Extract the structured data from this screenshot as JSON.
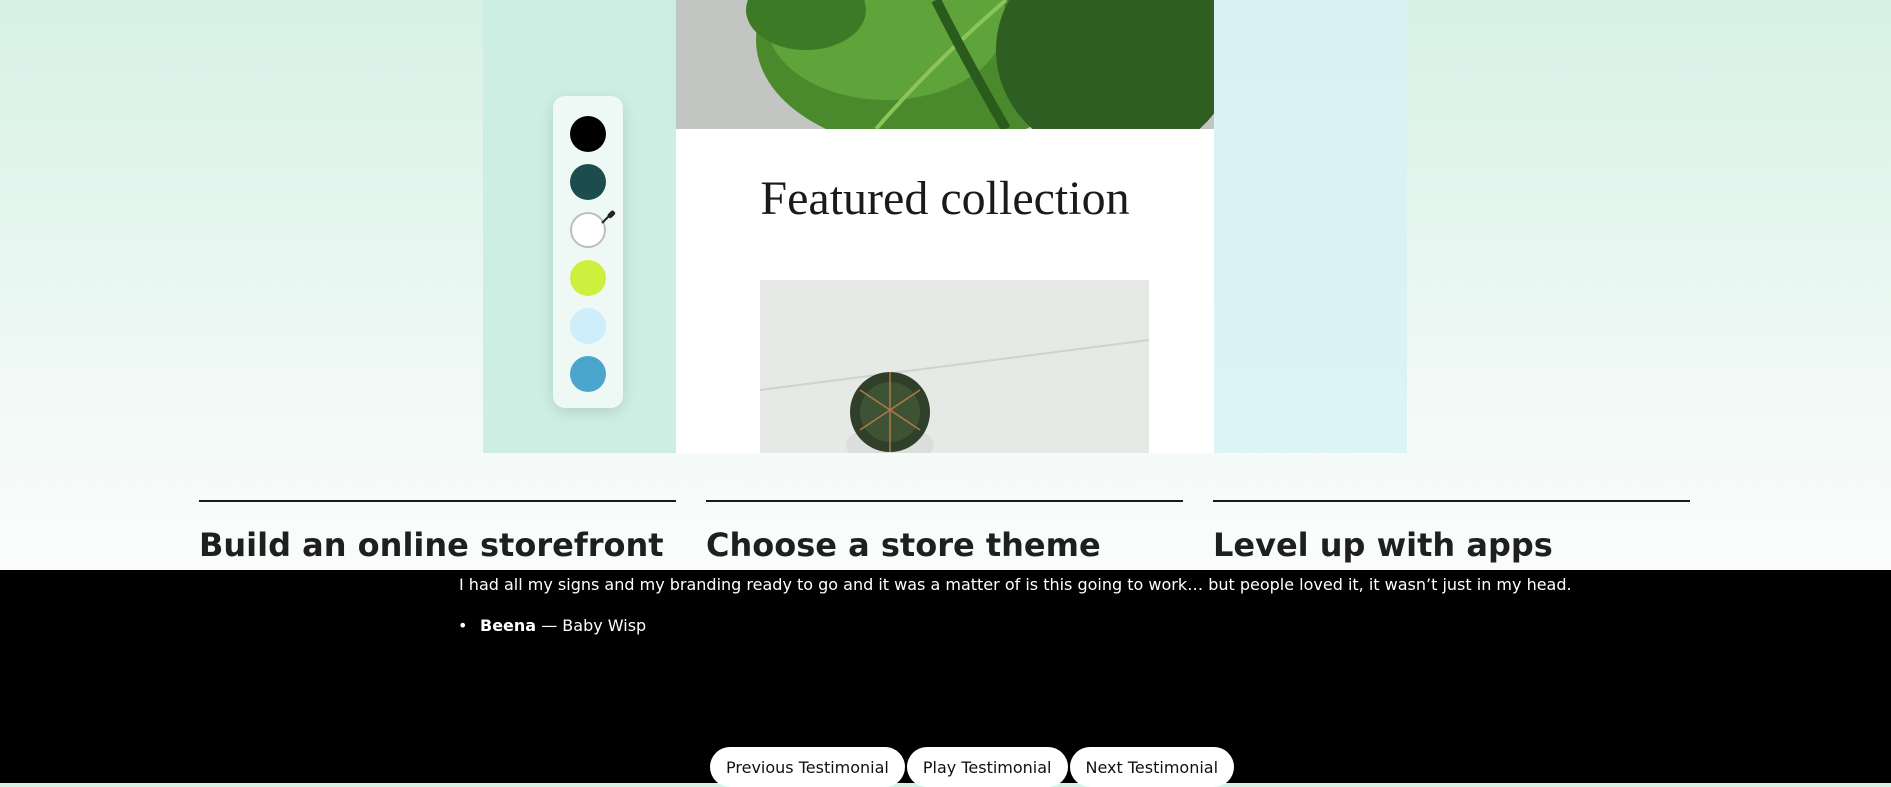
{
  "hero": {
    "card_title": "Featured collection",
    "palette": {
      "swatches": [
        {
          "name": "black",
          "color": "#000000"
        },
        {
          "name": "dark-teal",
          "color": "#1c4c4e"
        },
        {
          "name": "white",
          "color": "#ffffff"
        },
        {
          "name": "lime",
          "color": "#cdf03e"
        },
        {
          "name": "light-blue",
          "color": "#cdeefa"
        },
        {
          "name": "sky-blue",
          "color": "#4aa6cc"
        }
      ],
      "picker_icon": "eyedropper-icon"
    }
  },
  "features": [
    {
      "title": "Build an online storefront"
    },
    {
      "title": "Choose a store theme"
    },
    {
      "title": "Level up with apps"
    }
  ],
  "testimonial": {
    "quote": "I had all my signs and my branding ready to go and it was a matter of is this going to work… but people loved it, it wasn’t just in my head.",
    "author_name": "Beena",
    "author_separator": "—",
    "author_company": "Baby Wisp",
    "buttons": {
      "previous": "Previous Testimonial",
      "play": "Play Testimonial",
      "next": "Next Testimonial"
    }
  }
}
